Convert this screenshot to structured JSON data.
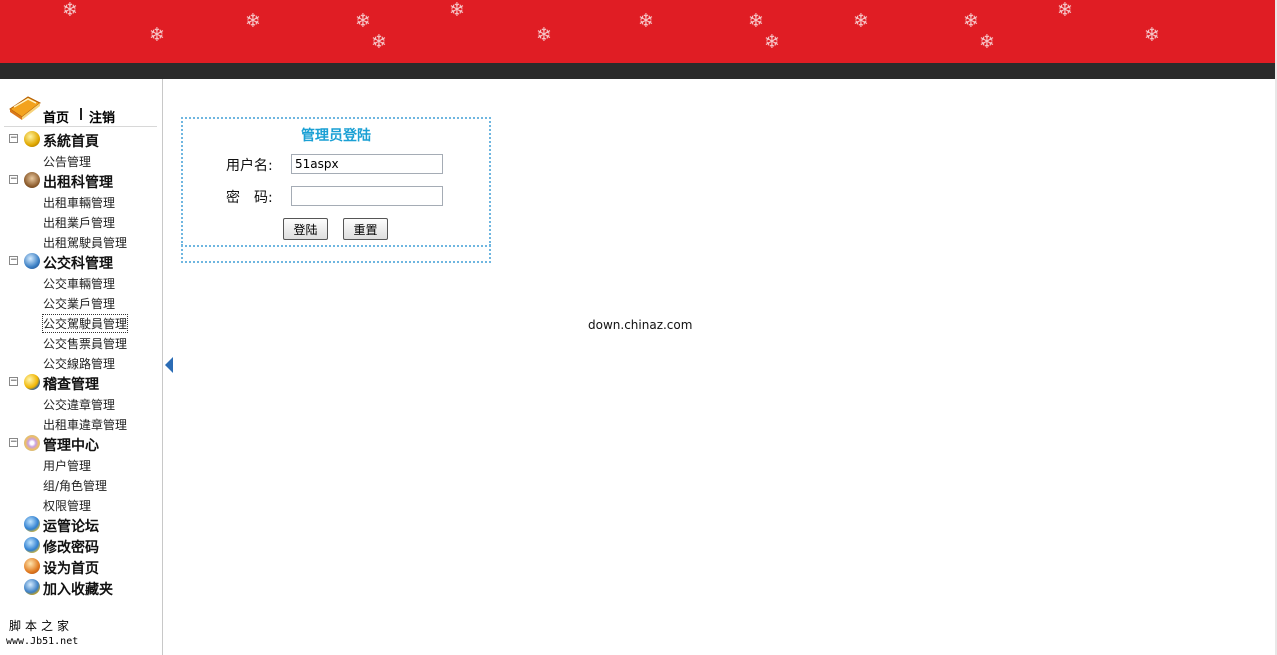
{
  "header": {
    "colors": {
      "header_bg": "#e01d24",
      "bar": "#2b2b2b",
      "accent": "#1aa0d4"
    },
    "snowflake_glyph": "❄"
  },
  "sidebar": {
    "home_label": "首页",
    "logout_label": "注销",
    "sections": [
      {
        "label": "系統首頁",
        "icon": "yellow-orb-icon",
        "items": [
          "公告管理"
        ]
      },
      {
        "label": "出租科管理",
        "icon": "owl-icon",
        "items": [
          "出租車輛管理",
          "出租業戶管理",
          "出租駕駛員管理"
        ]
      },
      {
        "label": "公交科管理",
        "icon": "globe-icon",
        "items": [
          "公交車輛管理",
          "公交業戶管理",
          "公交駕駛員管理",
          "公交售票員管理",
          "公交線路管理"
        ]
      },
      {
        "label": "稽查管理",
        "icon": "moon-icon",
        "items": [
          "公交違章管理",
          "出租車違章管理"
        ]
      },
      {
        "label": "管理中心",
        "icon": "cd-icon",
        "items": [
          "用户管理",
          "组/角色管理",
          "权限管理"
        ]
      }
    ],
    "extra_links": [
      {
        "label": "运管论坛",
        "icon": "earth-icon"
      },
      {
        "label": "修改密码",
        "icon": "earth-icon"
      },
      {
        "label": "设为首页",
        "icon": "home-page-icon"
      },
      {
        "label": "加入收藏夹",
        "icon": "favorites-icon"
      }
    ],
    "footer_name": "脚本之家",
    "footer_url": "www.Jb51.net"
  },
  "login": {
    "title": "管理员登陆",
    "username_label": "用户名:",
    "username_value": "51aspx",
    "password_label": "密　码:",
    "password_value": "",
    "login_button": "登陆",
    "reset_button": "重置"
  },
  "watermark": "down.chinaz.com"
}
